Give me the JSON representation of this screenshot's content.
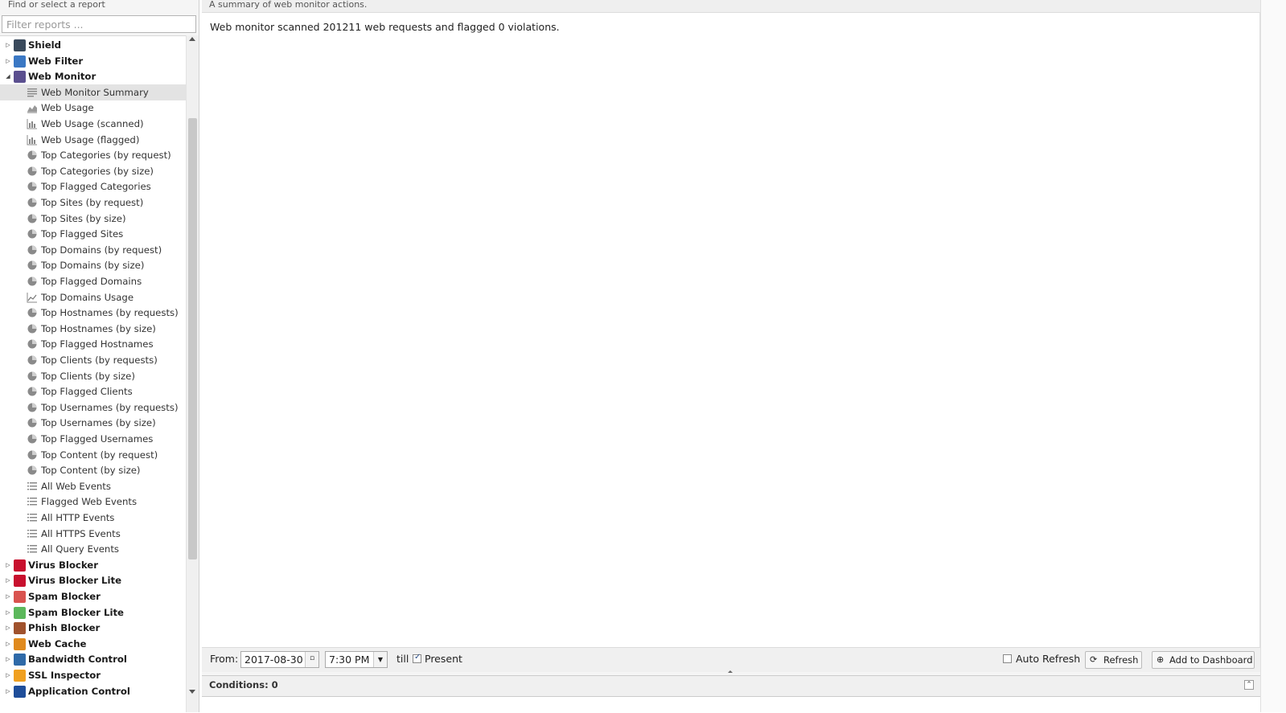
{
  "sidebar": {
    "header": "Find or select a report",
    "filter_placeholder": "Filter reports ...",
    "tree": [
      {
        "label": "Shield",
        "kind": "category",
        "state": "collapsed",
        "icon": "shield-app-icon"
      },
      {
        "label": "Web Filter",
        "kind": "category",
        "state": "collapsed",
        "icon": "web-filter-app-icon"
      },
      {
        "label": "Web Monitor",
        "kind": "category",
        "state": "expanded",
        "icon": "web-monitor-app-icon"
      },
      {
        "label": "Web Monitor Summary",
        "kind": "report",
        "icon": "text-report-icon",
        "selected": true
      },
      {
        "label": "Web Usage",
        "kind": "report",
        "icon": "area-chart-icon"
      },
      {
        "label": "Web Usage (scanned)",
        "kind": "report",
        "icon": "bar-chart-icon"
      },
      {
        "label": "Web Usage (flagged)",
        "kind": "report",
        "icon": "bar-chart-icon"
      },
      {
        "label": "Top Categories (by request)",
        "kind": "report",
        "icon": "pie-chart-icon"
      },
      {
        "label": "Top Categories (by size)",
        "kind": "report",
        "icon": "pie-chart-icon"
      },
      {
        "label": "Top Flagged Categories",
        "kind": "report",
        "icon": "pie-chart-icon"
      },
      {
        "label": "Top Sites (by request)",
        "kind": "report",
        "icon": "pie-chart-icon"
      },
      {
        "label": "Top Sites (by size)",
        "kind": "report",
        "icon": "pie-chart-icon"
      },
      {
        "label": "Top Flagged Sites",
        "kind": "report",
        "icon": "pie-chart-icon"
      },
      {
        "label": "Top Domains (by request)",
        "kind": "report",
        "icon": "pie-chart-icon"
      },
      {
        "label": "Top Domains (by size)",
        "kind": "report",
        "icon": "pie-chart-icon"
      },
      {
        "label": "Top Flagged Domains",
        "kind": "report",
        "icon": "pie-chart-icon"
      },
      {
        "label": "Top Domains Usage",
        "kind": "report",
        "icon": "line-chart-icon"
      },
      {
        "label": "Top Hostnames (by requests)",
        "kind": "report",
        "icon": "pie-chart-icon"
      },
      {
        "label": "Top Hostnames (by size)",
        "kind": "report",
        "icon": "pie-chart-icon"
      },
      {
        "label": "Top Flagged Hostnames",
        "kind": "report",
        "icon": "pie-chart-icon"
      },
      {
        "label": "Top Clients (by requests)",
        "kind": "report",
        "icon": "pie-chart-icon"
      },
      {
        "label": "Top Clients (by size)",
        "kind": "report",
        "icon": "pie-chart-icon"
      },
      {
        "label": "Top Flagged Clients",
        "kind": "report",
        "icon": "pie-chart-icon"
      },
      {
        "label": "Top Usernames (by requests)",
        "kind": "report",
        "icon": "pie-chart-icon"
      },
      {
        "label": "Top Usernames (by size)",
        "kind": "report",
        "icon": "pie-chart-icon"
      },
      {
        "label": "Top Flagged Usernames",
        "kind": "report",
        "icon": "pie-chart-icon"
      },
      {
        "label": "Top Content (by request)",
        "kind": "report",
        "icon": "pie-chart-icon"
      },
      {
        "label": "Top Content (by size)",
        "kind": "report",
        "icon": "pie-chart-icon"
      },
      {
        "label": "All Web Events",
        "kind": "report",
        "icon": "list-icon"
      },
      {
        "label": "Flagged Web Events",
        "kind": "report",
        "icon": "list-icon"
      },
      {
        "label": "All HTTP Events",
        "kind": "report",
        "icon": "list-icon"
      },
      {
        "label": "All HTTPS Events",
        "kind": "report",
        "icon": "list-icon"
      },
      {
        "label": "All Query Events",
        "kind": "report",
        "icon": "list-icon"
      },
      {
        "label": "Virus Blocker",
        "kind": "category",
        "state": "collapsed",
        "icon": "virus-blocker-app-icon"
      },
      {
        "label": "Virus Blocker Lite",
        "kind": "category",
        "state": "collapsed",
        "icon": "virus-blocker-lite-app-icon"
      },
      {
        "label": "Spam Blocker",
        "kind": "category",
        "state": "collapsed",
        "icon": "spam-blocker-app-icon"
      },
      {
        "label": "Spam Blocker Lite",
        "kind": "category",
        "state": "collapsed",
        "icon": "spam-blocker-lite-app-icon"
      },
      {
        "label": "Phish Blocker",
        "kind": "category",
        "state": "collapsed",
        "icon": "phish-blocker-app-icon"
      },
      {
        "label": "Web Cache",
        "kind": "category",
        "state": "collapsed",
        "icon": "web-cache-app-icon"
      },
      {
        "label": "Bandwidth Control",
        "kind": "category",
        "state": "collapsed",
        "icon": "bandwidth-control-app-icon"
      },
      {
        "label": "SSL Inspector",
        "kind": "category",
        "state": "collapsed",
        "icon": "ssl-inspector-app-icon"
      },
      {
        "label": "Application Control",
        "kind": "category",
        "state": "collapsed",
        "icon": "application-control-app-icon"
      }
    ]
  },
  "report": {
    "description": "A summary of web monitor actions.",
    "summary_text": "Web monitor scanned 201211 web requests and flagged 0 violations."
  },
  "toolbar": {
    "from_label": "From:",
    "from_date": "2017-08-30",
    "from_time": "7:30 PM",
    "till_label": "till",
    "present_label": "Present",
    "present_checked": true,
    "auto_refresh_label": "Auto Refresh",
    "auto_refresh_checked": false,
    "refresh_label": "Refresh",
    "add_dashboard_label": "Add to Dashboard"
  },
  "conditions": {
    "label": "Conditions: 0"
  }
}
